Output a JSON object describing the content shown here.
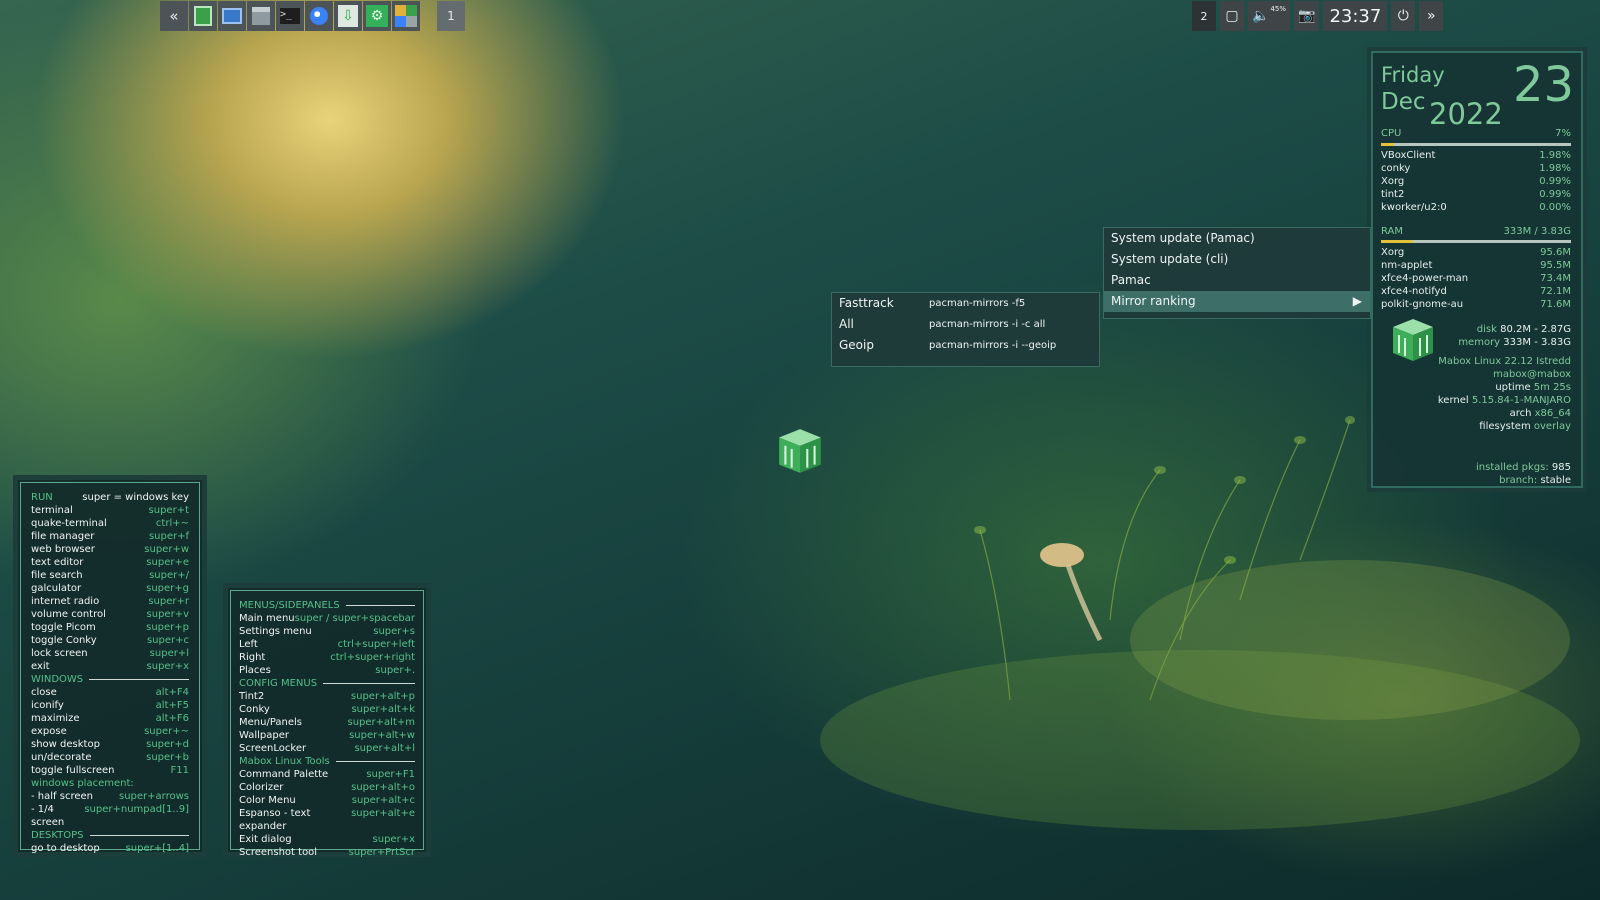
{
  "launcher": {
    "collapse_icon": "double-chevron-left",
    "workspace_label": "1"
  },
  "tray": {
    "desktop_label": "2",
    "volume_percent": "45%",
    "time": "23:37",
    "expand_icon": "double-chevron-right"
  },
  "conky": {
    "day": "Friday",
    "month": "Dec",
    "year": "2022",
    "date": "23",
    "cpu_label": "CPU",
    "cpu_value": "7%",
    "cpu_fraction": 0.07,
    "cpu_procs": [
      {
        "name": "VBoxClient",
        "val": "1.98%"
      },
      {
        "name": "conky",
        "val": "1.98%"
      },
      {
        "name": "Xorg",
        "val": "0.99%"
      },
      {
        "name": "tint2",
        "val": "0.99%"
      },
      {
        "name": "kworker/u2:0",
        "val": "0.00%"
      }
    ],
    "ram_label": "RAM",
    "ram_value": "333M / 3.83G",
    "ram_fraction": 0.17,
    "ram_procs": [
      {
        "name": "Xorg",
        "val": "95.6M"
      },
      {
        "name": "nm-applet",
        "val": "95.5M"
      },
      {
        "name": "xfce4-power-man",
        "val": "73.4M"
      },
      {
        "name": "xfce4-notifyd",
        "val": "72.1M"
      },
      {
        "name": "polkit-gnome-au",
        "val": "71.6M"
      }
    ],
    "disk_label": "disk",
    "disk_value": "80.2M - 2.87G",
    "memory_label": "memory",
    "memory_value": "333M - 3.83G",
    "distro": "Mabox Linux 22.12 Istredd",
    "user": "mabox@mabox",
    "uptime_label": "uptime",
    "uptime_value": "5m 25s",
    "kernel_label": "kernel",
    "kernel_value": "5.15.84-1-MANJARO",
    "arch_label": "arch",
    "arch_value": "x86_64",
    "fs_label": "filesystem",
    "fs_value": "overlay",
    "pkgs_label": "installed pkgs:",
    "pkgs_value": "985",
    "branch_label": "branch:",
    "branch_value": "stable"
  },
  "menu": {
    "items": [
      {
        "label": "System update (Pamac)"
      },
      {
        "label": "System update (cli)"
      },
      {
        "label": "Pamac"
      },
      {
        "label": "Mirror ranking",
        "arrow": "▶"
      }
    ]
  },
  "submenu": {
    "items": [
      {
        "label": "Fasttrack",
        "cmd": "pacman-mirrors -f5"
      },
      {
        "label": "All",
        "cmd": "pacman-mirrors -i -c all"
      },
      {
        "label": "Geoip",
        "cmd": "pacman-mirrors -i --geoip"
      }
    ]
  },
  "left_panel": {
    "run_title": "RUN",
    "run_hint": "super = windows key",
    "run": [
      {
        "label": "terminal",
        "key": "super+t"
      },
      {
        "label": "quake-terminal",
        "key": "ctrl+~"
      },
      {
        "label": "file manager",
        "key": "super+f"
      },
      {
        "label": "web browser",
        "key": "super+w"
      },
      {
        "label": "text editor",
        "key": "super+e"
      },
      {
        "label": "file search",
        "key": "super+/"
      },
      {
        "label": "galculator",
        "key": "super+g"
      },
      {
        "label": "internet radio",
        "key": "super+r"
      },
      {
        "label": "volume control",
        "key": "super+v"
      },
      {
        "label": "toggle Picom",
        "key": "super+p"
      },
      {
        "label": "toggle Conky",
        "key": "super+c"
      },
      {
        "label": "lock screen",
        "key": "super+l"
      },
      {
        "label": "exit",
        "key": "super+x"
      }
    ],
    "windows_title": "WINDOWS",
    "windows": [
      {
        "label": "close",
        "key": "alt+F4"
      },
      {
        "label": "iconify",
        "key": "alt+F5"
      },
      {
        "label": "maximize",
        "key": "alt+F6"
      },
      {
        "label": "expose",
        "key": "super+~"
      },
      {
        "label": "show desktop",
        "key": "super+d"
      },
      {
        "label": "un/decorate",
        "key": "super+b"
      },
      {
        "label": "toggle fullscreen",
        "key": "F11"
      }
    ],
    "placement_title": "windows placement:",
    "placement": [
      {
        "label": " - half screen",
        "key": "super+arrows"
      },
      {
        "label": " - 1/4 screen",
        "key": "super+numpad[1..9]"
      }
    ],
    "desktops_title": "DESKTOPS",
    "desktops": [
      {
        "label": "go to desktop",
        "key": "super+[1..4]"
      }
    ]
  },
  "mid_panel": {
    "menus_title": "MENUS/SIDEPANELS",
    "menus": [
      {
        "label": "Main menu",
        "key": "super / super+spacebar"
      },
      {
        "label": "Settings menu",
        "key": "super+s"
      },
      {
        "label": "Left",
        "key": "ctrl+super+left"
      },
      {
        "label": "Right",
        "key": "ctrl+super+right"
      },
      {
        "label": "Places",
        "key": "super+."
      }
    ],
    "config_title": "CONFIG MENUS",
    "config": [
      {
        "label": "Tint2",
        "key": "super+alt+p"
      },
      {
        "label": "Conky",
        "key": "super+alt+k"
      },
      {
        "label": "Menu/Panels",
        "key": "super+alt+m"
      },
      {
        "label": "Wallpaper",
        "key": "super+alt+w"
      },
      {
        "label": "ScreenLocker",
        "key": "super+alt+l"
      }
    ],
    "tools_title": "Mabox Linux Tools",
    "tools": [
      {
        "label": "Command Palette",
        "key": "super+F1"
      },
      {
        "label": "Colorizer",
        "key": "super+alt+o"
      },
      {
        "label": "Color Menu",
        "key": "super+alt+c"
      },
      {
        "label": "Espanso - text expander",
        "key": "super+alt+e"
      },
      {
        "label": "Exit dialog",
        "key": "super+x"
      },
      {
        "label": "Screenshot tool",
        "key": "super+PrtScr"
      }
    ]
  }
}
